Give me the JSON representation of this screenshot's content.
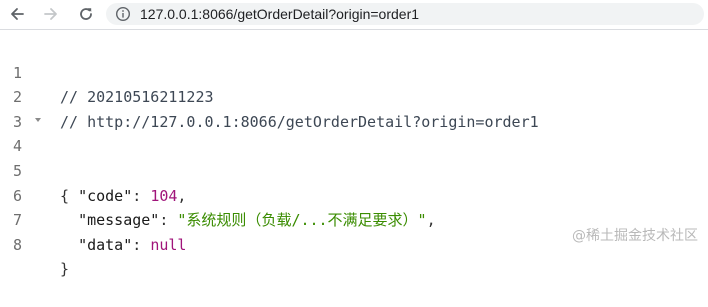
{
  "browser": {
    "url_host": "127.0.0.1",
    "url_rest": ":8066/getOrderDetail?origin=order1"
  },
  "code": {
    "line_numbers": [
      "1",
      "2",
      "3",
      "4",
      "5",
      "6",
      "7",
      "8"
    ],
    "comment1": "// 20210516211223",
    "comment2": "// http://127.0.0.1:8066/getOrderDetail?origin=order1",
    "open_brace": "{",
    "code_key": "\"code\"",
    "code_value": "104",
    "message_key": "\"message\"",
    "message_value": "\"系统规则（负载/...不满足要求）\"",
    "data_key": "\"data\"",
    "data_value": "null",
    "close_brace": "}",
    "colon": ": ",
    "comma": ",",
    "indent": "  "
  },
  "watermark": "@稀土掘金技术社区",
  "colors": {
    "number": "#a0147a",
    "string": "#3a8c00",
    "literal": "#a0147a"
  },
  "icons": {
    "back": "arrow-left-icon",
    "forward": "arrow-right-icon",
    "reload": "reload-icon",
    "info": "info-icon",
    "fold": "triangle-down-icon"
  }
}
